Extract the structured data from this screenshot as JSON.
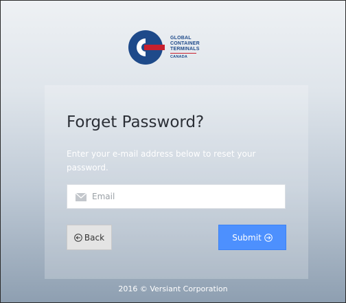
{
  "logo": {
    "line1": "GLOBAL",
    "line2": "CONTAINER",
    "line3": "TERMINALS",
    "line4": "CANADA",
    "brand_blue": "#1e4a8a",
    "brand_red": "#c8202e"
  },
  "form": {
    "title": "Forget Password?",
    "description": "Enter your e-mail address below to reset your password.",
    "email": {
      "value": "",
      "placeholder": "Email",
      "icon": "envelope-icon"
    },
    "back_label": "Back",
    "back_icon": "circle-arrow-left-icon",
    "submit_label": "Submit",
    "submit_icon": "circle-arrow-right-icon",
    "submit_color": "#4d90fe"
  },
  "footer": {
    "text": "2016 © Versiant Corporation"
  }
}
